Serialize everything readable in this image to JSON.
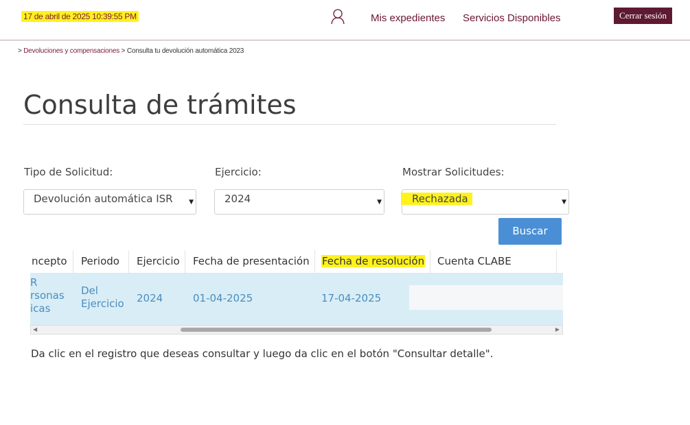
{
  "header": {
    "timestamp": "17 de abril de 2025 10:39:55 PM",
    "nav": [
      "Mis expedientes",
      "Servicios Disponibles"
    ],
    "logout_label": "Cerrar sesión",
    "icons": {
      "user": "user-icon"
    }
  },
  "breadcrumb": {
    "sep1": "> ",
    "item1": "Devoluciones y compensaciones",
    "sep2": " > ",
    "item2": "Consulta tu devolución automática 2023"
  },
  "page_title": "Consulta de trámites",
  "filters": {
    "tipo": {
      "label": "Tipo de Solicitud:",
      "value": "Devolución automática ISR"
    },
    "ejercicio": {
      "label": "Ejercicio:",
      "value": "2024"
    },
    "mostrar": {
      "label": "Mostrar Solicitudes:",
      "value": "Rechazada"
    }
  },
  "search_label": "Buscar",
  "table": {
    "headers": [
      "ncepto",
      "Periodo",
      "Ejercicio",
      "Fecha de presentación",
      "Fecha de resolución",
      "Cuenta CLABE"
    ],
    "row": {
      "concepto": [
        "R",
        "rsonas",
        "icas"
      ],
      "periodo": [
        "Del",
        "Ejercicio"
      ],
      "ejercicio": "2024",
      "fecha_presentacion": "01-04-2025",
      "fecha_resolucion": "17-04-2025",
      "cuenta_clabe": ""
    }
  },
  "hint": "Da clic en el registro que deseas consultar y luego da clic en el botón \"Consultar detalle\".",
  "colors": {
    "brand": "#5e1a32",
    "highlight": "#fff21d",
    "accent": "#4a8fd6",
    "row_bg": "#d9edf6"
  }
}
